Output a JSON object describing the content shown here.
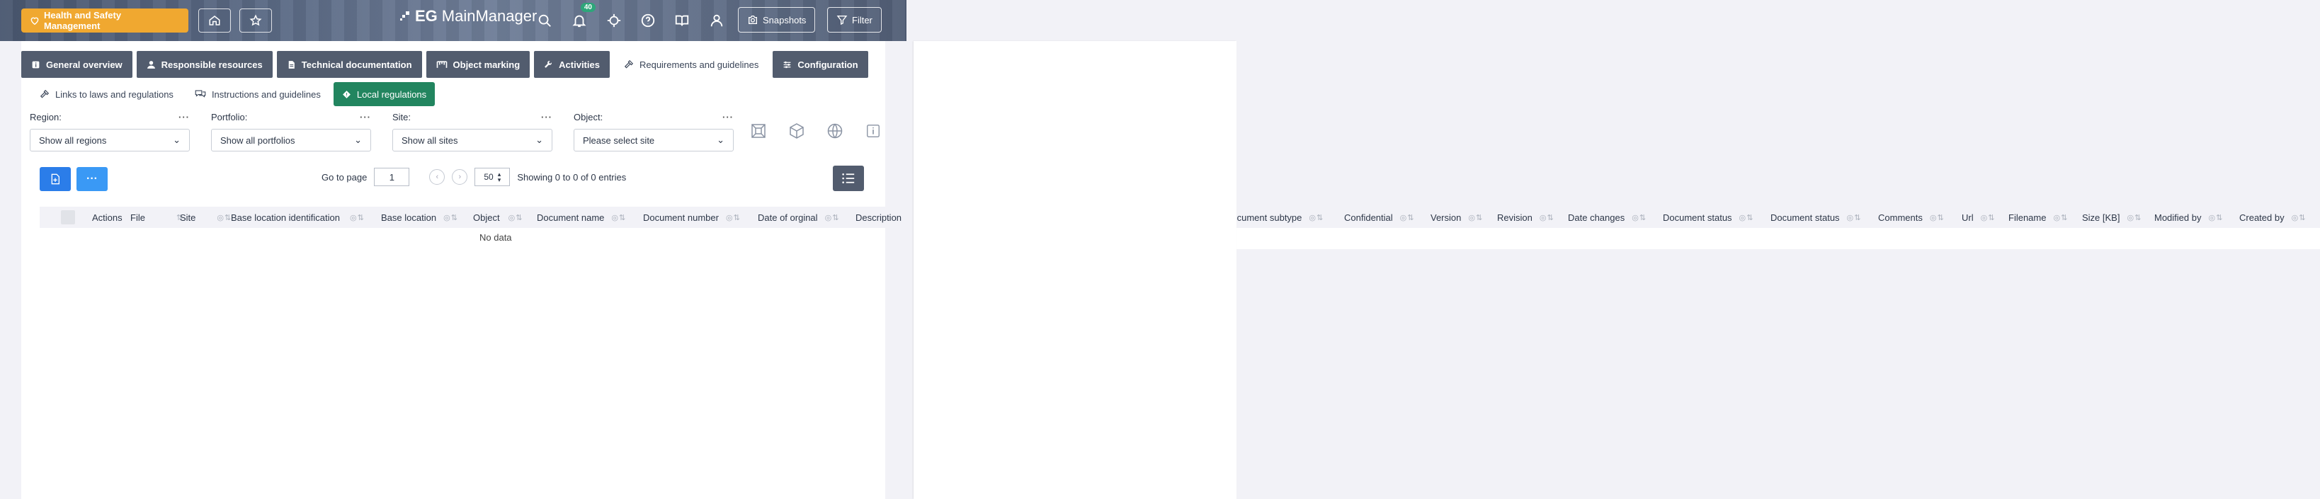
{
  "header": {
    "module_button": "Health and Safety Management",
    "logo_text_bold": "EG",
    "logo_text": "MainManager",
    "notification_count": "40",
    "snapshots_label": "Snapshots",
    "filter_label": "Filter"
  },
  "tabs": [
    {
      "label": "General overview",
      "icon": "info-icon"
    },
    {
      "label": "Responsible resources",
      "icon": "person-icon"
    },
    {
      "label": "Technical documentation",
      "icon": "document-icon"
    },
    {
      "label": "Object marking",
      "icon": "marking-icon"
    },
    {
      "label": "Activities",
      "icon": "wrench-icon"
    },
    {
      "label": "Requirements and guidelines",
      "icon": "hammer-icon",
      "active": true
    },
    {
      "label": "Configuration",
      "icon": "sliders-icon"
    }
  ],
  "subtabs": [
    {
      "label": "Links to laws and regulations",
      "icon": "gavel-icon"
    },
    {
      "label": "Instructions and guidelines",
      "icon": "chat-icon"
    },
    {
      "label": "Local regulations",
      "icon": "diamond-icon",
      "active": true
    }
  ],
  "filters": {
    "region": {
      "label": "Region:",
      "value": "Show all regions"
    },
    "portfolio": {
      "label": "Portfolio:",
      "value": "Show all portfolios"
    },
    "site": {
      "label": "Site:",
      "value": "Show all sites"
    },
    "object": {
      "label": "Object:",
      "value": "Please select site"
    }
  },
  "pager": {
    "go_to_page_label": "Go to page",
    "page_value": "1",
    "page_size": "50",
    "summary": "Showing 0 to 0 of 0 entries"
  },
  "table": {
    "columns_left": [
      "Actions",
      "File",
      "Site",
      "Base location identification",
      "Base location",
      "Object",
      "Document name",
      "Document number",
      "Date of orginal",
      "Description"
    ],
    "columns_right": [
      "Document subtype",
      "Confidential",
      "Version",
      "Revision",
      "Date changes",
      "Document status",
      "Document status",
      "Comments",
      "Url",
      "Filename",
      "Size [KB]",
      "Modified by",
      "Created by"
    ],
    "empty_text": "No data"
  },
  "colors": {
    "accent_orange": "#f0a830",
    "tab_dark": "#525c6e",
    "active_green": "#22855f",
    "action_blue": "#2b7de9"
  }
}
